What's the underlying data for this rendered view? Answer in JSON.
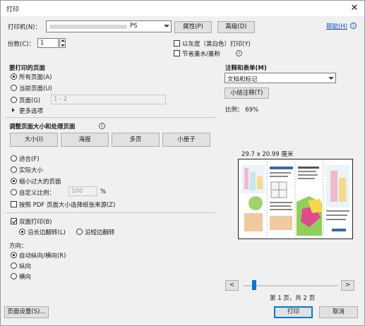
{
  "window": {
    "title": "打印",
    "close_glyph": "✕"
  },
  "printer": {
    "label": "打印机(N)：",
    "selected_suffix": "PS",
    "properties_btn": "属性(P)",
    "advanced_btn": "高级(D)",
    "help_link": "帮助(H)"
  },
  "copies": {
    "label": "份数(C)：",
    "value": "1"
  },
  "options": {
    "grayscale": "以灰度（黑白色）打印(Y)",
    "save_ink": "节省墨水/墨粉"
  },
  "pages": {
    "title": "要打印的页面",
    "all": "所有页面(A)",
    "current": "当前页面(U)",
    "range": "页面(G)",
    "range_placeholder": "1 - 2",
    "more": "更多选项"
  },
  "sizing": {
    "title": "调整页面大小和处理页面",
    "tabs": [
      "大小(I)",
      "海报",
      "多页",
      "小册子"
    ],
    "fit": "适合(F)",
    "actual": "实际大小",
    "shrink": "缩小过大的页面",
    "custom": "自定义比例：",
    "custom_value": "100",
    "percent": "%",
    "pdf_source": "按照 PDF 页面大小选择纸张来源(Z)"
  },
  "duplex": {
    "label": "双面打印(B)",
    "long_edge": "沿长边翻转(L)",
    "short_edge": "沿短边翻转"
  },
  "orientation": {
    "title": "方向：",
    "auto": "自动纵向/横向(R)",
    "portrait": "纵向",
    "landscape": "横向"
  },
  "comments": {
    "title": "注释和表单(M)",
    "selected": "文档和标记",
    "summarize_btn": "小结注释(T)"
  },
  "preview": {
    "scale": "比例： 69%",
    "size": "29.7 x 20.99 厘米",
    "page_info": "第 1 页，共 2 页",
    "prev": "<",
    "next": ">"
  },
  "footer": {
    "page_setup": "页面设置(S)...",
    "print": "打印",
    "cancel": "取消"
  },
  "colors": {
    "accent": "#0078d7",
    "link": "#0a4fc0",
    "dialog_bg": "#f0f0f0"
  }
}
